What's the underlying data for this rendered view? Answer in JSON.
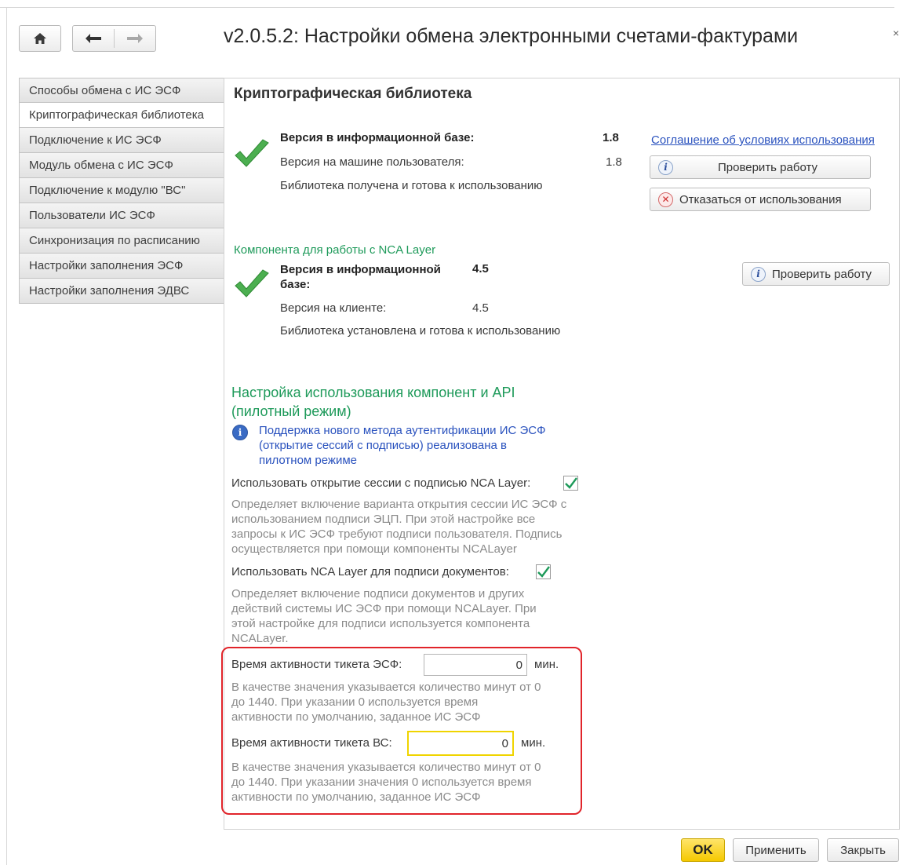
{
  "window": {
    "title": "v2.0.5.2: Настройки обмена электронными счетами-фактурами",
    "close_glyph": "×"
  },
  "sidebar": {
    "items": [
      {
        "label": "Способы обмена с ИС ЭСФ"
      },
      {
        "label": "Криптографическая библиотека",
        "active": true
      },
      {
        "label": "Подключение к ИС ЭСФ"
      },
      {
        "label": "Модуль обмена с ИС ЭСФ"
      },
      {
        "label": "Подключение к модулю \"ВС\""
      },
      {
        "label": "Пользователи ИС ЭСФ"
      },
      {
        "label": "Синхронизация по расписанию"
      },
      {
        "label": "Настройки заполнения ЭСФ"
      },
      {
        "label": "Настройки заполнения ЭДВС"
      }
    ]
  },
  "crypto": {
    "title": "Криптографическая библиотека",
    "db_version_label": "Версия в информационной базе:",
    "db_version_value": "1.8",
    "user_version_label": "Версия на машине пользователя:",
    "user_version_value": "1.8",
    "status": "Библиотека получена и готова к использованию",
    "agreement_link": "Соглашение об условиях использования",
    "check_button": "Проверить работу",
    "refuse_button": "Отказаться от использования"
  },
  "nca": {
    "title": "Компонента для работы с NCA Layer",
    "db_version_label_line1": "Версия в информационной",
    "db_version_label_line2": "базе:",
    "db_version_value": "4.5",
    "client_version_label": "Версия на клиенте:",
    "client_version_value": "4.5",
    "status": "Библиотека установлена и готова к использованию",
    "check_button": "Проверить работу"
  },
  "api": {
    "title_line1": "Настройка использования компонент и API",
    "title_line2": "(пилотный режим)",
    "info_line1": "Поддержка нового метода аутентификации ИС ЭСФ",
    "info_line2": "(открытие сессий с подписью) реализована в",
    "info_line3": "пилотном режиме",
    "session_label": "Использовать открытие сессии с подписью NCA Layer:",
    "session_checked": true,
    "session_desc_1": "Определяет включение варианта открытия сессии ИС ЭСФ с",
    "session_desc_2": "использованием подписи ЭЦП. При этой настройке все",
    "session_desc_3": "запросы к ИС ЭСФ требуют подписи пользователя. Подпись",
    "session_desc_4": "осуществляется при помощи компоненты NCALayer",
    "sign_label": "Использовать NCA Layer для подписи документов:",
    "sign_checked": true,
    "sign_desc_1": "Определяет включение подписи документов и других",
    "sign_desc_2": "действий системы ИС ЭСФ при помощи NCALayer. При",
    "sign_desc_3": "этой настройке для подписи используется компонента",
    "sign_desc_4": "NCALayer."
  },
  "tickets": {
    "esf_label": "Время активности тикета ЭСФ:",
    "esf_value": "0",
    "esf_unit": "мин.",
    "esf_desc_1": "В качестве значения указывается количество минут от 0",
    "esf_desc_2": "до 1440. При указании 0 используется время",
    "esf_desc_3": "активности по умолчанию, заданное ИС ЭСФ",
    "vs_label": "Время активности тикета ВС:",
    "vs_value": "0",
    "vs_unit": "мин.",
    "vs_desc_1": "В качестве значения указывается количество минут от 0",
    "vs_desc_2": "до 1440. При указании значения 0 используется время",
    "vs_desc_3": "активности по умолчанию, заданное ИС ЭСФ"
  },
  "footer": {
    "ok": "OK",
    "apply": "Применить",
    "close": "Закрыть"
  },
  "colors": {
    "accent_green": "#1e9a5a",
    "link_blue": "#2a52be",
    "highlight_red": "#e1242a",
    "ok_yellow": "#f5c900"
  }
}
